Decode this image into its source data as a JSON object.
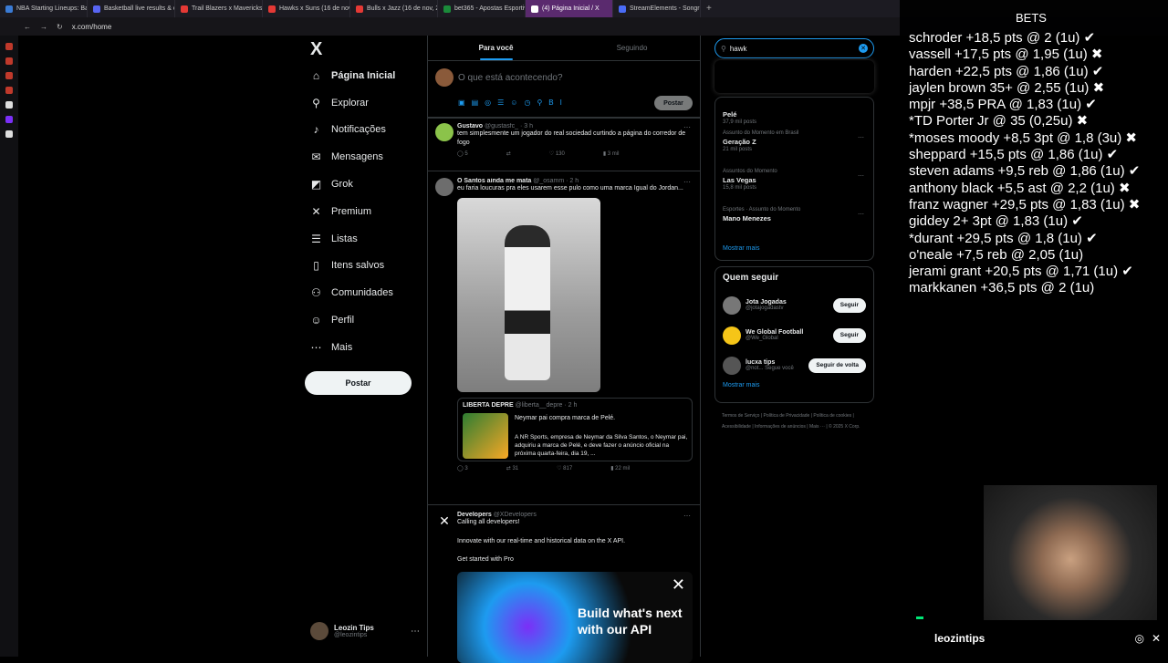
{
  "browser": {
    "tabs": [
      {
        "label": "NBA Starting Lineups: Ba",
        "color": "#3a7bd5"
      },
      {
        "label": "Basketball live results & o",
        "color": "#5865f2"
      },
      {
        "label": "Trail Blazers x Mavericks",
        "color": "#e53935"
      },
      {
        "label": "Hawks x Suns (16 de nov",
        "color": "#e53935"
      },
      {
        "label": "Bulls x Jazz (16 de nov, 2",
        "color": "#e53935"
      },
      {
        "label": "bet365 - Apostas Esportiv",
        "color": "#1b8a3a"
      },
      {
        "label": "(4) Página Inicial / X",
        "color": "#ffffff"
      },
      {
        "label": "StreamElements - Songre",
        "color": "#4a6cf7"
      }
    ],
    "new_tab": "+",
    "address": "x.com/home"
  },
  "nav": {
    "logo": "X",
    "items": [
      {
        "label": "Página Inicial",
        "icon": "home-icon",
        "glyph": "⌂"
      },
      {
        "label": "Explorar",
        "icon": "search-icon",
        "glyph": "⚲"
      },
      {
        "label": "Notificações",
        "icon": "bell-icon",
        "glyph": "♪"
      },
      {
        "label": "Mensagens",
        "icon": "mail-icon",
        "glyph": "✉"
      },
      {
        "label": "Grok",
        "icon": "grok-icon",
        "glyph": "◩"
      },
      {
        "label": "Premium",
        "icon": "x-premium-icon",
        "glyph": "✕"
      },
      {
        "label": "Listas",
        "icon": "list-icon",
        "glyph": "☰"
      },
      {
        "label": "Itens salvos",
        "icon": "bookmark-icon",
        "glyph": "▯"
      },
      {
        "label": "Comunidades",
        "icon": "communities-icon",
        "glyph": "⚇"
      },
      {
        "label": "Perfil",
        "icon": "profile-icon",
        "glyph": "☺"
      },
      {
        "label": "Mais",
        "icon": "more-icon",
        "glyph": "⋯"
      }
    ],
    "post_button": "Postar",
    "account": {
      "name": "Leozin Tips",
      "handle": "@leozintips"
    }
  },
  "feed": {
    "tabs": [
      "Para você",
      "Seguindo"
    ],
    "compose_placeholder": "O que está acontecendo?",
    "compose_post": "Postar",
    "tweets": [
      {
        "name": "Gustavo",
        "handle": "@gustasfc_ · 3 h",
        "text": "tem simplesmente um jogador do real sociedad curtindo a página do corredor de fogo",
        "replies": "5",
        "likes": "130",
        "views": "3 mil"
      },
      {
        "name": "O Santos ainda me mata",
        "handle": "@_osamm · 2 h",
        "text": "eu faria loucuras pra eles usarem esse pulo como uma marca  Igual do Jordan...",
        "quote_name": "LIBERTA DEPRE",
        "quote_handle": "@liberta__depre · 2 h",
        "quote_title": "Neymar pai compra marca de Pelé.",
        "quote_body": "A NR Sports, empresa de Neymar da Silva Santos, o Neymar pai, adquiriu a marca de Pelé, e deve fazer o anúncio oficial na próxima quarta-feira, dia 19, ...",
        "replies": "3",
        "retweets": "31",
        "likes": "817",
        "views": "22 mil"
      },
      {
        "name": "Developers",
        "handle": "@XDevelopers",
        "line1": "Calling all developers!",
        "line2": "Innovate with our real-time and historical data on the X API.",
        "line3": "Get started with Pro",
        "ad_text": "Build what's next with our API"
      }
    ]
  },
  "right": {
    "search_value": "hawk",
    "trends": [
      {
        "cat": "",
        "title": "Pelé",
        "posts": "37,9 mil posts"
      },
      {
        "cat": "Assunto do Momento em Brasil",
        "title": "Geração Z",
        "posts": "21 mil posts"
      },
      {
        "cat": "Assuntos do Momento",
        "title": "Las Vegas",
        "posts": "15,8 mil posts"
      },
      {
        "cat": "Esportes · Assunto do Momento",
        "title": "Mano Menezes",
        "posts": ""
      }
    ],
    "show_more": "Mostrar mais",
    "who_title": "Quem seguir",
    "who": [
      {
        "name": "Jota Jogadas",
        "handle": "@jotajogadastv",
        "btn": "Seguir"
      },
      {
        "name": "We Global Football",
        "handle": "@We_Global",
        "btn": "Seguir"
      },
      {
        "name": "lucxa tips",
        "handle": "@not...  Segue você",
        "btn": "Seguir de volta"
      }
    ],
    "footer": "Termos de Serviço | Política de Privacidade | Política de cookies | Acessibilidade | Informações de anúncios | Mais ··· | © 2025 X Corp."
  },
  "overlay": {
    "title": "BETS",
    "bets": [
      "schroder +18,5 pts @ 2 (1u) ✔",
      "vassell +17,5 pts @ 1,95 (1u) ✖",
      "harden +22,5 pts @ 1,86 (1u) ✔",
      "jaylen brown 35+ @ 2,55 (1u) ✖",
      "mpjr +38,5 PRA @ 1,83 (1u) ✔",
      "*TD Porter Jr @ 35 (0,25u) ✖",
      "*moses moody +8,5 3pt @ 1,8 (3u) ✖",
      "sheppard +15,5 pts @ 1,86 (1u) ✔",
      "steven adams +9,5 reb @ 1,86 (1u) ✔",
      "anthony black +5,5 ast @ 2,2 (1u) ✖",
      "franz wagner +29,5 pts @ 1,83 (1u) ✖",
      "giddey 2+ 3pt @ 1,83 (1u) ✔",
      "*durant +29,5 pts @ 1,8 (1u) ✔",
      "o'neale +7,5 reb @ 2,05 (1u)",
      "jerami grant +20,5 pts @ 1,71 (1u) ✔",
      "markkanen +36,5 pts @ 2 (1u)"
    ],
    "streamer": "leozintips"
  }
}
